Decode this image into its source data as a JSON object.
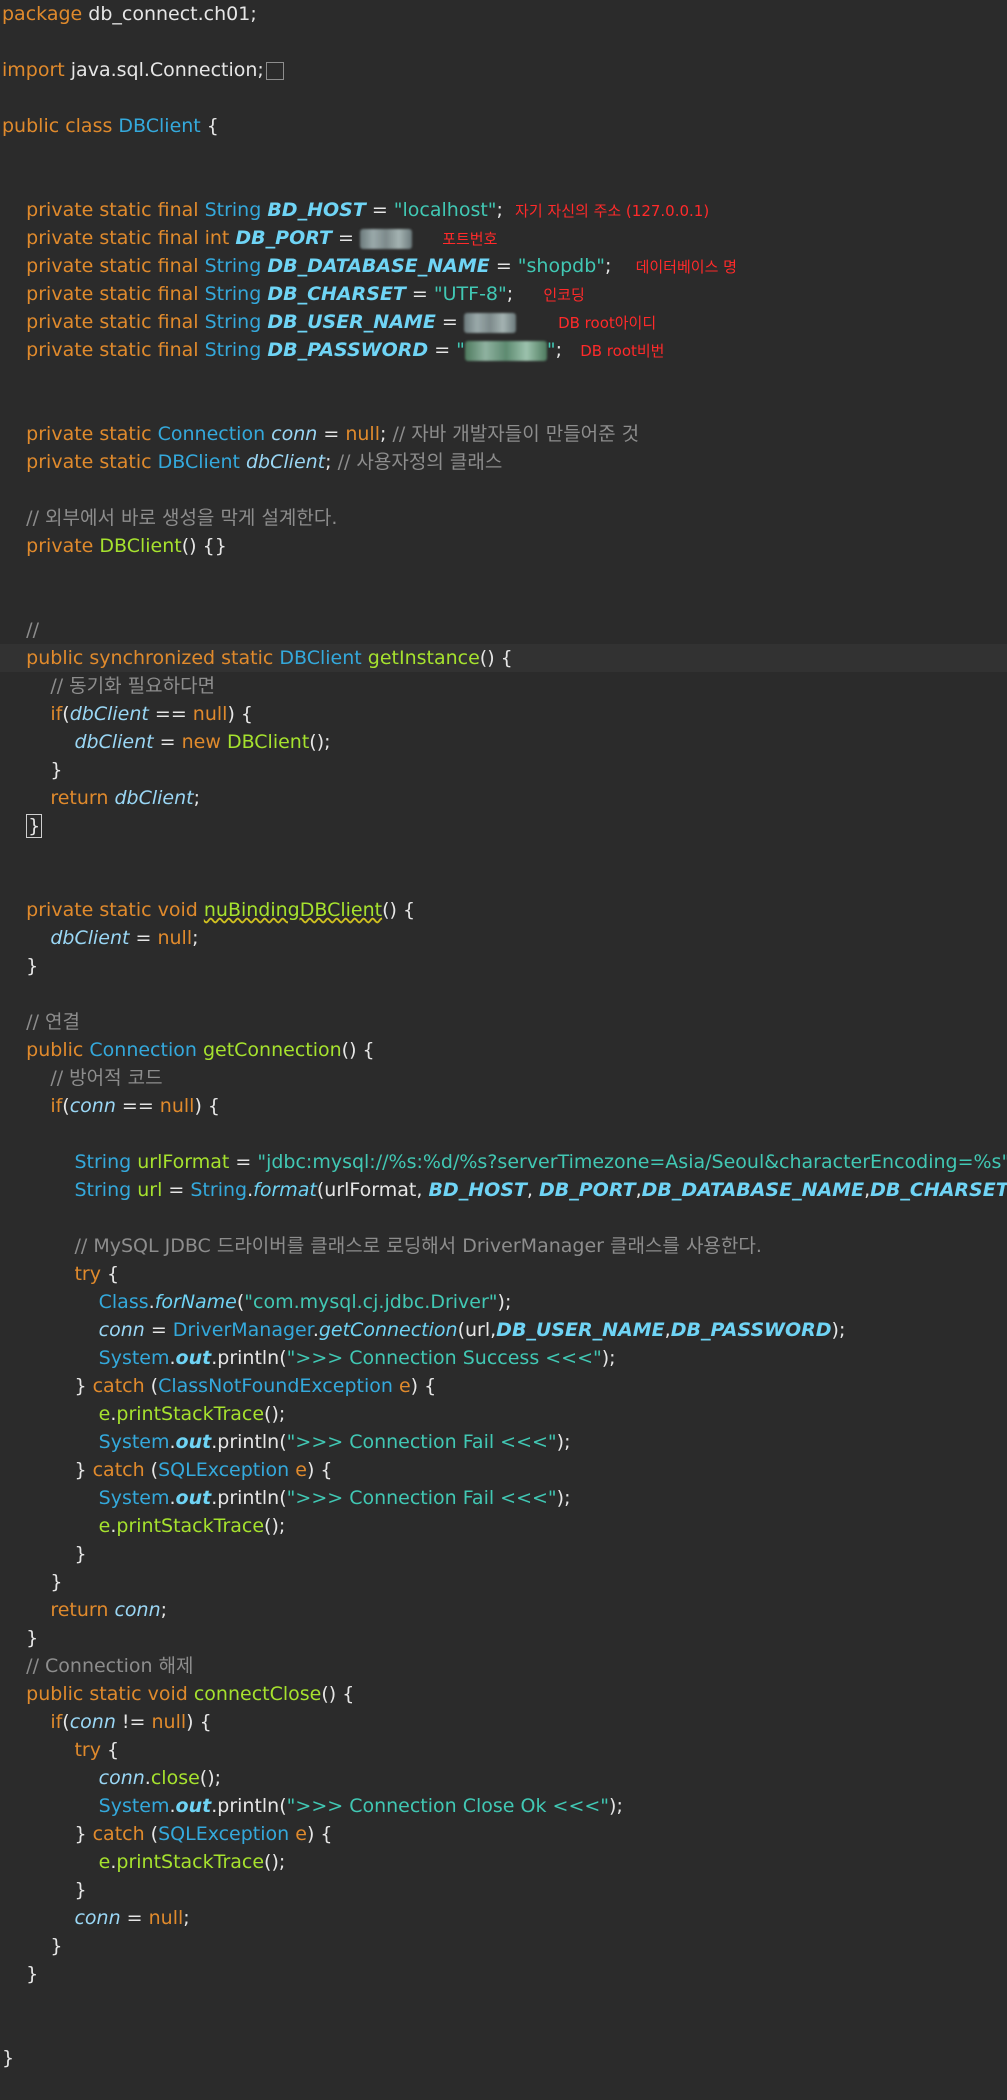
{
  "code": {
    "package_kw": "package",
    "package_name": "db_connect.ch01;",
    "import_kw": "import",
    "import_name": "java.sql.Connection;",
    "class_decl": "public class",
    "class_name": "DBClient",
    "fields": {
      "modifier": "private static final",
      "type_string": "String",
      "type_int": "int",
      "bd_host": "BD_HOST",
      "bd_host_value": "\"localhost\"",
      "db_port": "DB_PORT",
      "db_database_name": "DB_DATABASE_NAME",
      "db_database_name_value": "\"shopdb\"",
      "db_charset": "DB_CHARSET",
      "db_charset_value": "\"UTF-8\"",
      "db_user_name": "DB_USER_NAME",
      "db_password": "DB_PASSWORD"
    },
    "annotations": {
      "host": "자기 자신의 주소 (127.0.0.1)",
      "port": "포트번호",
      "database": "데이터베이스 명",
      "charset": "인코딩",
      "user": "DB root아이디",
      "password": "DB root비번"
    },
    "conn_field": {
      "modifier": "private static",
      "type": "Connection",
      "name": "conn",
      "null": "null",
      "comment": "// 자바 개발자들이 만들어준 것"
    },
    "client_field": {
      "modifier": "private static",
      "type": "DBClient",
      "name": "dbClient",
      "comment": "// 사용자정의 클래스"
    },
    "comment_ctor": "// 외부에서 바로 생성을 막게 설계한다.",
    "ctor": {
      "modifier": "private",
      "name": "DBClient",
      "body": "() {}"
    },
    "comment_slash": "//",
    "get_instance": {
      "modifier": "public synchronized static",
      "type": "DBClient",
      "name": "getInstance",
      "comment": "// 동기화 필요하다면",
      "if_kw": "if",
      "var": "dbClient",
      "null": "null",
      "new_kw": "new",
      "ctor": "DBClient",
      "return_kw": "return"
    },
    "unbinding": {
      "modifier": "private static void",
      "name": "nuBindingDBClient",
      "var": "dbClient",
      "null": "null"
    },
    "comment_connect": "// 연결",
    "get_connection": {
      "modifier": "public",
      "type": "Connection",
      "name": "getConnection",
      "comment_defensive": "// 방어적 코드",
      "if_kw": "if",
      "var": "conn",
      "null": "null",
      "string_type": "String",
      "url_format_var": "urlFormat",
      "url_format_value": "\"jdbc:mysql://%s:%d/%s?serverTimezone=Asia/Seoul&characterEncoding=%s\";",
      "url_var": "url",
      "format_method": "format",
      "format_args": "(urlFormat, ",
      "comment_driver": "// MySQL JDBC 드라이버를 클래스로 로딩해서 DriverManager 클래스를 사용한다.",
      "try_kw": "try",
      "class_type": "Class",
      "for_name": "forName",
      "driver_string": "\"com.mysql.cj.jdbc.Driver\"",
      "driver_manager": "DriverManager",
      "get_connection_call": "getConnection",
      "system": "System",
      "out": "out",
      "println": "println",
      "msg_success": "\">>> Connection Success <<<\"",
      "catch_kw": "catch",
      "cnfe": "ClassNotFoundException",
      "e": "e",
      "print_stack_trace": "printStackTrace",
      "msg_fail": "\">>> Connection Fail <<<\"",
      "sql_exception": "SQLException",
      "return_kw": "return"
    },
    "comment_close": "// Connection 해제",
    "connect_close": {
      "modifier": "public static void",
      "name": "connectClose",
      "if_kw": "if",
      "var": "conn",
      "null": "null",
      "close": "close",
      "msg_close": "\">>> Connection Close Ok <<<\""
    }
  }
}
